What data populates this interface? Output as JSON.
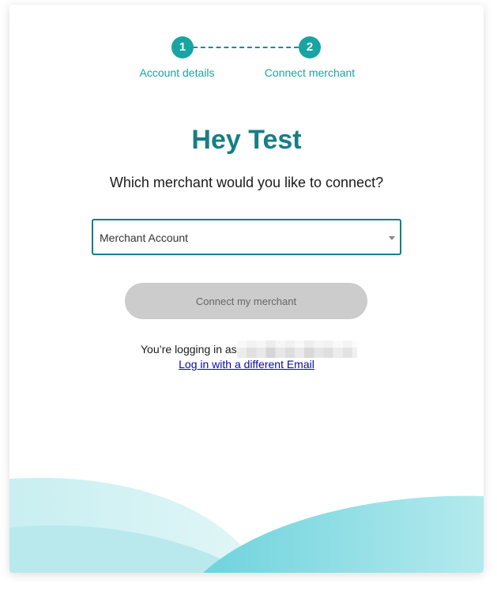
{
  "stepper": {
    "steps": [
      {
        "number": "1",
        "label": "Account details"
      },
      {
        "number": "2",
        "label": "Connect merchant"
      }
    ]
  },
  "greeting": "Hey Test",
  "question": "Which merchant would you like to connect?",
  "merchant_select": {
    "selected": "Merchant Account"
  },
  "connect_button": {
    "label": "Connect my merchant",
    "enabled": false
  },
  "login_info": {
    "prefix": "You’re logging in as",
    "alt_login_link": "Log in with a different Email"
  },
  "colors": {
    "accent": "#1aa3a3",
    "heading": "#167e85",
    "button_disabled_bg": "#cccccc",
    "link": "#0a0aa5",
    "wave_light": "#d4f2f3",
    "wave_mid": "#b2e9ec",
    "wave_strong": "#7fd9e1"
  }
}
